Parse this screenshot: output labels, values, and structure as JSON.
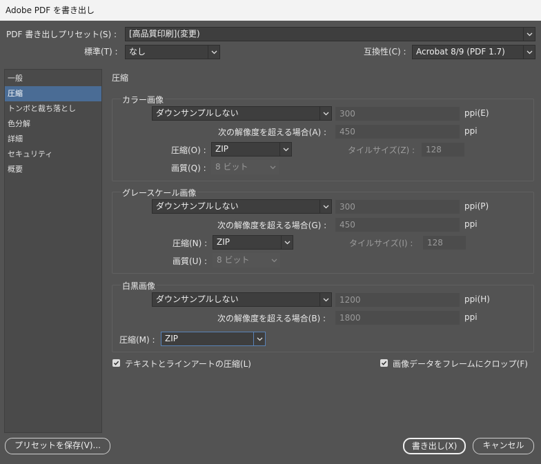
{
  "window": {
    "title": "Adobe PDF を書き出し"
  },
  "header": {
    "preset_label": "PDF 書き出しプリセット(S) :",
    "preset_value": "[高品質印刷](変更)",
    "standard_label": "標準(T) :",
    "standard_value": "なし",
    "compat_label": "互換性(C) :",
    "compat_value": "Acrobat 8/9 (PDF 1.7)"
  },
  "sidebar": {
    "items": [
      {
        "label": "一般"
      },
      {
        "label": "圧縮"
      },
      {
        "label": "トンボと裁ち落とし"
      },
      {
        "label": "色分解"
      },
      {
        "label": "詳細"
      },
      {
        "label": "セキュリティ"
      },
      {
        "label": "概要"
      }
    ],
    "active": "圧縮"
  },
  "section": {
    "title": "圧縮"
  },
  "color": {
    "title": "カラー画像",
    "sampling": "ダウンサンプルしない",
    "ppi_value": "300",
    "ppi_unit": "ppi(E)",
    "above_label": "次の解像度を超える場合(A) :",
    "above_value": "450",
    "above_unit": "ppi",
    "comp_label": "圧縮(O) :",
    "comp_value": "ZIP",
    "tile_label": "タイルサイズ(Z) :",
    "tile_value": "128",
    "quality_label": "画質(Q) :",
    "quality_value": "8 ビット"
  },
  "gray": {
    "title": "グレースケール画像",
    "sampling": "ダウンサンプルしない",
    "ppi_value": "300",
    "ppi_unit": "ppi(P)",
    "above_label": "次の解像度を超える場合(G) :",
    "above_value": "450",
    "above_unit": "ppi",
    "comp_label": "圧縮(N) :",
    "comp_value": "ZIP",
    "tile_label": "タイルサイズ(I) :",
    "tile_value": "128",
    "quality_label": "画質(U) :",
    "quality_value": "8 ビット"
  },
  "mono": {
    "title": "白黒画像",
    "sampling": "ダウンサンプルしない",
    "ppi_value": "1200",
    "ppi_unit": "ppi(H)",
    "above_label": "次の解像度を超える場合(B) :",
    "above_value": "1800",
    "above_unit": "ppi",
    "comp_label": "圧縮(M) :",
    "comp_value": "ZIP"
  },
  "options": {
    "text_art_label": "テキストとラインアートの圧縮(L)",
    "text_art_checked": true,
    "crop_label": "画像データをフレームにクロップ(F)",
    "crop_checked": true
  },
  "footer": {
    "save_preset": "プリセットを保存(V)...",
    "export": "書き出し(X)",
    "cancel": "キャンセル"
  },
  "colors": {
    "accent": "#4a6c95",
    "background": "#535353"
  }
}
